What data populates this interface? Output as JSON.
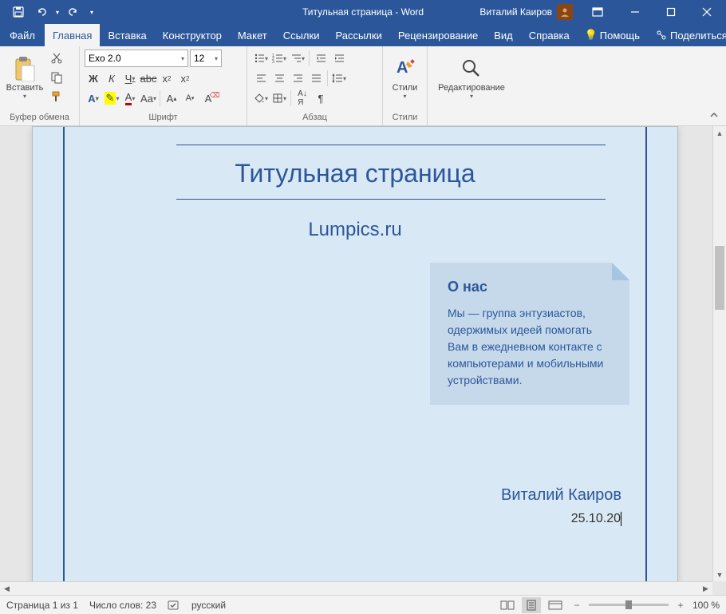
{
  "titlebar": {
    "title": "Титульная страница - Word",
    "user": "Виталий Каиров"
  },
  "tabs": {
    "file": "Файл",
    "home": "Главная",
    "insert": "Вставка",
    "design": "Конструктор",
    "layout": "Макет",
    "references": "Ссылки",
    "mailings": "Рассылки",
    "review": "Рецензирование",
    "view": "Вид",
    "help": "Справка",
    "help_btn": "Помощь",
    "share": "Поделиться"
  },
  "ribbon": {
    "clipboard": {
      "paste": "Вставить",
      "label": "Буфер обмена"
    },
    "font": {
      "name": "Exo 2.0",
      "size": "12",
      "label": "Шрифт"
    },
    "paragraph": {
      "label": "Абзац"
    },
    "styles": {
      "btn": "Стили",
      "label": "Стили"
    },
    "editing": {
      "btn": "Редактирование"
    }
  },
  "document": {
    "title": "Титульная страница",
    "subtitle": "Lumpics.ru",
    "box_heading": "О нас",
    "box_text": "Мы — группа энтузиастов, одержимых идеей помогать Вам в ежедневном контакте с компьютерами и мобильными устройствами.",
    "author": "Виталий Каиров",
    "date": "25.10.20"
  },
  "status": {
    "page": "Страница 1 из 1",
    "words": "Число слов: 23",
    "lang": "русский",
    "zoom": "100 %"
  }
}
